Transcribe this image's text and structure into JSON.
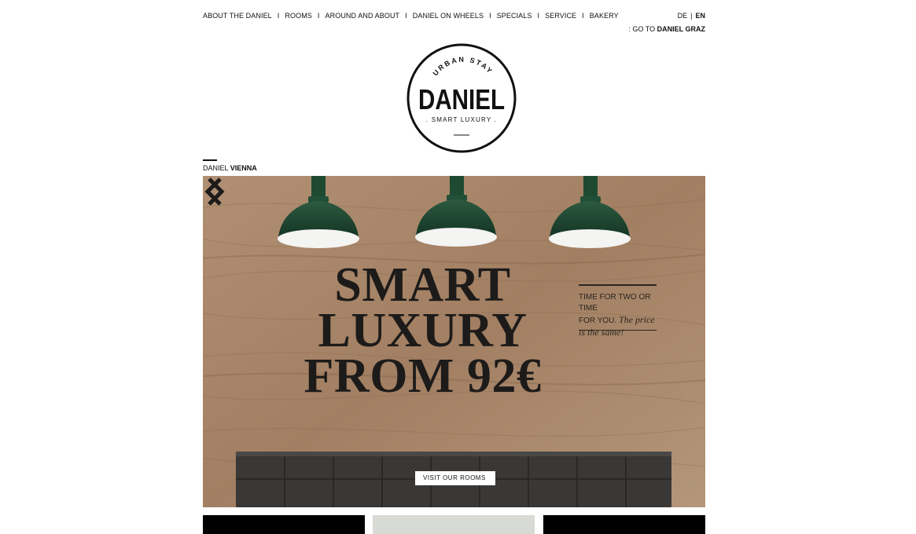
{
  "nav": {
    "items": [
      {
        "label": "ABOUT THE DANIEL"
      },
      {
        "label": "ROOMS"
      },
      {
        "label": "AROUND AND ABOUT"
      },
      {
        "label": "DANIEL ON WHEELS"
      },
      {
        "label": "SPECIALS"
      },
      {
        "label": "SERVICE"
      },
      {
        "label": "BAKERY"
      }
    ],
    "separator": "I"
  },
  "lang": {
    "de": "DE",
    "separator": "|",
    "en": "EN",
    "active": "EN"
  },
  "goto": {
    "prefix": ": GO TO",
    "target": "DANIEL GRAZ"
  },
  "logo": {
    "top_text": "URBAN STAY",
    "name": "DANIEL",
    "sub_text": ". SMART LUXURY ."
  },
  "location": {
    "brand": "DANIEL",
    "city": "VIENNA"
  },
  "hero": {
    "headline_1": "SMART",
    "headline_2": "LUXURY",
    "headline_3": "FROM 92€",
    "tagline_1": "TIME FOR TWO OR TIME",
    "tagline_2": "FOR YOU.",
    "tagline_script_1": "The price",
    "tagline_script_2": "is the same!",
    "cta_label": "VISIT OUR ROOMS",
    "arrow_left_icon": "chevron-left-icon",
    "arrow_right_icon": "chevron-right-icon"
  },
  "colors": {
    "wood": "#a8876a",
    "lamp_green": "#1f4a33",
    "ink": "#1d1b1a",
    "headboard": "#3c3a39"
  }
}
